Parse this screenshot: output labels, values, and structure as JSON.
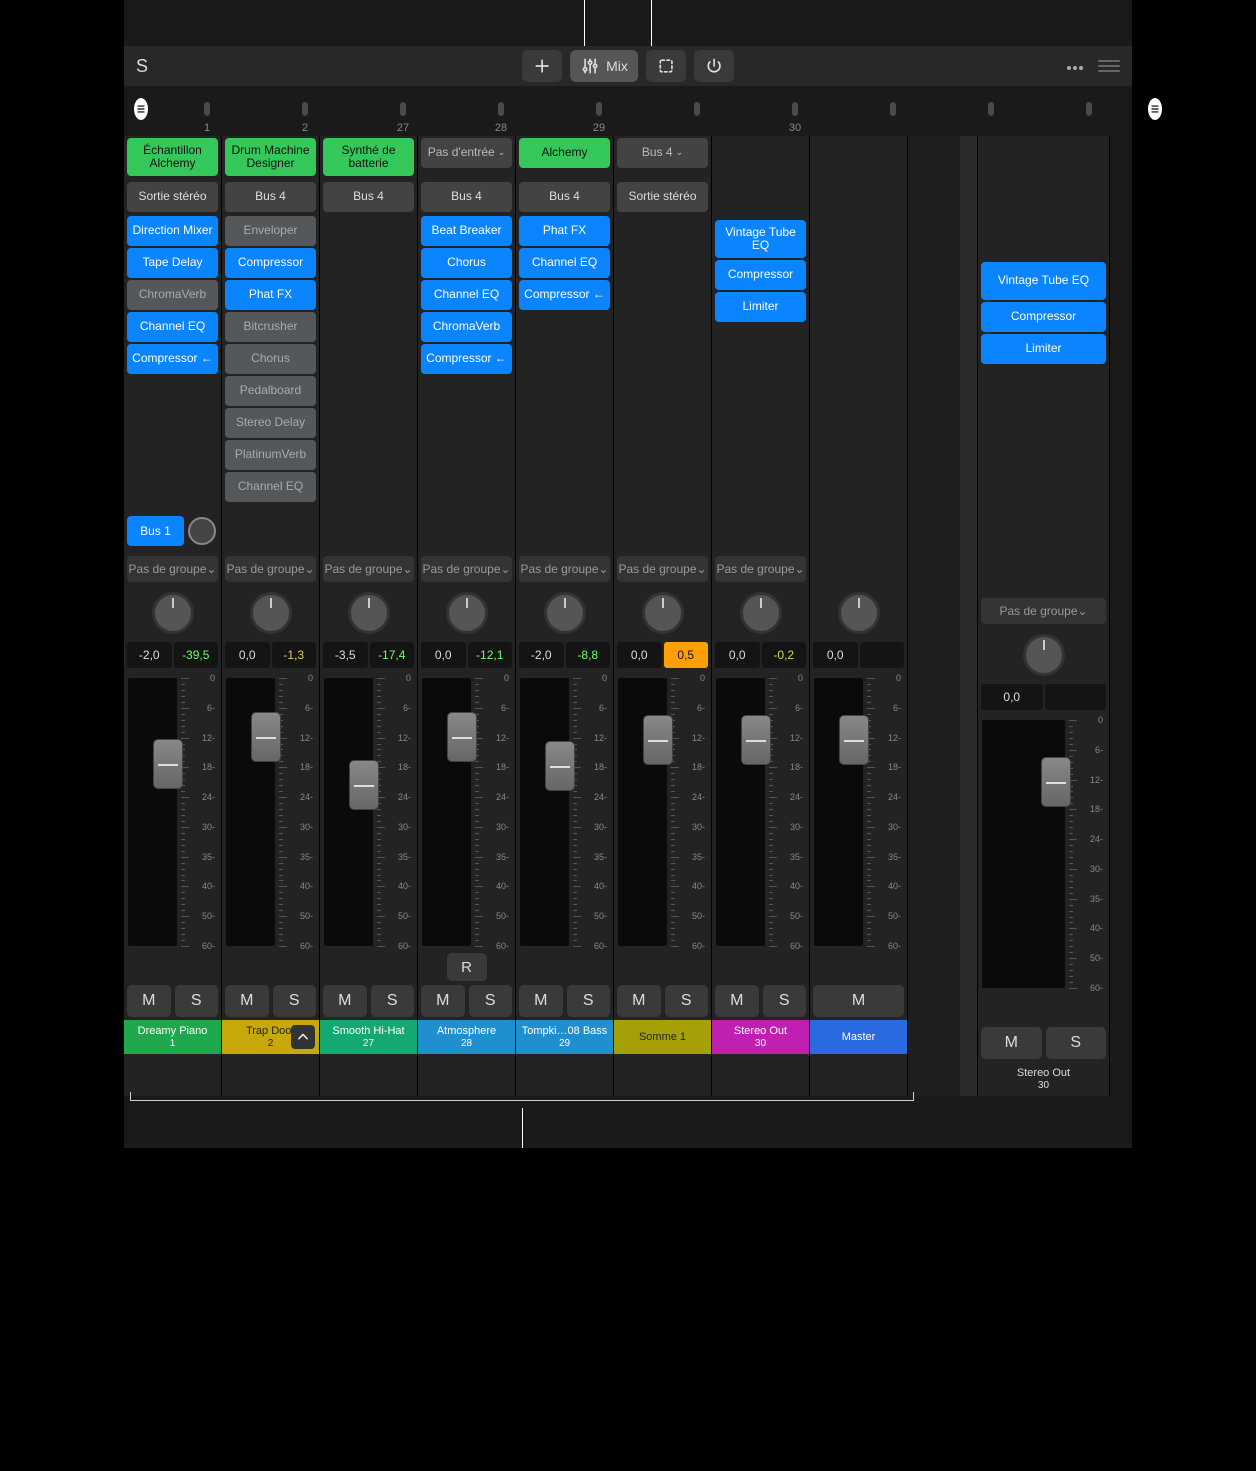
{
  "topbar": {
    "side_s": "S",
    "mix_label": "Mix"
  },
  "overview": {
    "track_numbers": [
      "1",
      "2",
      "27",
      "28",
      "29",
      "",
      "30",
      "",
      "",
      ""
    ]
  },
  "group_label": "Pas de groupe",
  "no_input_label": "Pas d'entrée",
  "channels": [
    {
      "instrument": {
        "label": "Échantillon Alchemy",
        "style": "green",
        "h2": true
      },
      "output": {
        "label": "Sortie stéréo",
        "style": "dark"
      },
      "plugins": [
        {
          "label": "Direction Mixer",
          "style": "blue"
        },
        {
          "label": "Tape Delay",
          "style": "blue"
        },
        {
          "label": "ChromaVerb",
          "style": "muted"
        },
        {
          "label": "Channel EQ",
          "style": "blue"
        },
        {
          "label": "Compressor ←",
          "style": "blue"
        }
      ],
      "send": {
        "label": "Bus 1",
        "knob": true
      },
      "group": true,
      "val_left": "-2,0",
      "val_right": "-39,5",
      "peak_style": "peak",
      "fader_pos": 0.32,
      "rec": false,
      "mute": true,
      "solo": true,
      "name": "Dreamy Piano",
      "num": "1",
      "bar": "green"
    },
    {
      "instrument": {
        "label": "Drum Machine Designer",
        "style": "green",
        "h2": true
      },
      "output": {
        "label": "Bus 4",
        "style": "dark"
      },
      "plugins": [
        {
          "label": "Enveloper",
          "style": "muted"
        },
        {
          "label": "Compressor",
          "style": "blue"
        },
        {
          "label": "Phat FX",
          "style": "blue"
        },
        {
          "label": "Bitcrusher",
          "style": "muted"
        },
        {
          "label": "Chorus",
          "style": "muted"
        },
        {
          "label": "Pedalboard",
          "style": "muted"
        },
        {
          "label": "Stereo Delay",
          "style": "muted"
        },
        {
          "label": "PlatinumVerb",
          "style": "muted"
        },
        {
          "label": "Channel EQ",
          "style": "muted"
        }
      ],
      "group": true,
      "val_left": "0,0",
      "val_right": "-1,3",
      "peak_style": "yellow",
      "fader_pos": 0.22,
      "rec": false,
      "mute": true,
      "solo": true,
      "name": "Trap Door",
      "num": "2",
      "bar": "yellow",
      "expand": true
    },
    {
      "instrument": {
        "label": "Synthé de batterie",
        "style": "green",
        "h2": true
      },
      "output": {
        "label": "Bus 4",
        "style": "dark"
      },
      "plugins": [],
      "group": true,
      "val_left": "-3,5",
      "val_right": "-17,4",
      "peak_style": "peak",
      "fader_pos": 0.4,
      "rec": false,
      "mute": true,
      "solo": true,
      "name": "Smooth Hi-Hat",
      "num": "27",
      "bar": "teal"
    },
    {
      "instrument": {
        "label": "Pas d'entrée",
        "style": "sel",
        "caret": true,
        "h2": false
      },
      "output": {
        "label": "Bus 4",
        "style": "dark"
      },
      "plugins": [
        {
          "label": "Beat Breaker",
          "style": "blue"
        },
        {
          "label": "Chorus",
          "style": "blue"
        },
        {
          "label": "Channel EQ",
          "style": "blue"
        },
        {
          "label": "ChromaVerb",
          "style": "blue"
        },
        {
          "label": "Compressor ←",
          "style": "blue"
        }
      ],
      "group": true,
      "val_left": "0,0",
      "val_right": "-12,1",
      "peak_style": "peak",
      "fader_pos": 0.22,
      "rec": true,
      "mute": true,
      "solo": true,
      "name": "Atmosphere",
      "num": "28",
      "bar": "cyan"
    },
    {
      "instrument": {
        "label": "Alchemy",
        "style": "green",
        "h2": false
      },
      "output": {
        "label": "Bus 4",
        "style": "dark"
      },
      "plugins": [
        {
          "label": "Phat FX",
          "style": "blue"
        },
        {
          "label": "Channel EQ",
          "style": "blue"
        },
        {
          "label": "Compressor ←",
          "style": "blue"
        }
      ],
      "group": true,
      "val_left": "-2,0",
      "val_right": "-8,8",
      "peak_style": "peak",
      "fader_pos": 0.33,
      "rec": false,
      "mute": true,
      "solo": true,
      "name": "Tompki…08 Bass",
      "num": "29",
      "bar": "cyan"
    },
    {
      "instrument": {
        "label": "Bus 4",
        "style": "sel",
        "caret": true,
        "h2": false
      },
      "output": {
        "label": "Sortie stéréo",
        "style": "dark"
      },
      "plugins": [],
      "group": true,
      "val_left": "0,0",
      "val_right": "0,5",
      "peak_style": "orange",
      "fader_pos": 0.23,
      "rec": false,
      "mute": true,
      "solo": true,
      "name": "Somme 1",
      "num": "",
      "bar": "olive"
    },
    {
      "output": null,
      "plugins": [
        {
          "label": "Vintage Tube EQ",
          "style": "blue",
          "h2": true
        },
        {
          "label": "Compressor",
          "style": "blue"
        },
        {
          "label": "Limiter",
          "style": "blue"
        }
      ],
      "group": true,
      "val_left": "0,0",
      "val_right": "-0,2",
      "peak_style": "yellow",
      "fader_pos": 0.23,
      "rec": false,
      "mute": true,
      "solo": true,
      "name": "Stereo Out",
      "num": "30",
      "bar": "magenta"
    },
    {
      "output": null,
      "plugins": [],
      "group": false,
      "val_left": "0,0",
      "val_right": "",
      "peak_style": "dim",
      "fader_pos": 0.23,
      "rec": false,
      "mute": true,
      "solo": false,
      "name": "Master",
      "num": "",
      "bar": "blue"
    }
  ],
  "master": {
    "plugins": [
      {
        "label": "Vintage Tube EQ",
        "style": "blue",
        "h2": true
      },
      {
        "label": "Compressor",
        "style": "blue"
      },
      {
        "label": "Limiter",
        "style": "blue"
      }
    ],
    "group": true,
    "val_left": "0,0",
    "val_right": "",
    "fader_pos": 0.23,
    "name": "Stereo Out",
    "num": "30"
  },
  "fader_scale": [
    "0",
    "6-",
    "12-",
    "18-",
    "24-",
    "30-",
    "35-",
    "40-",
    "50-",
    "60-"
  ]
}
